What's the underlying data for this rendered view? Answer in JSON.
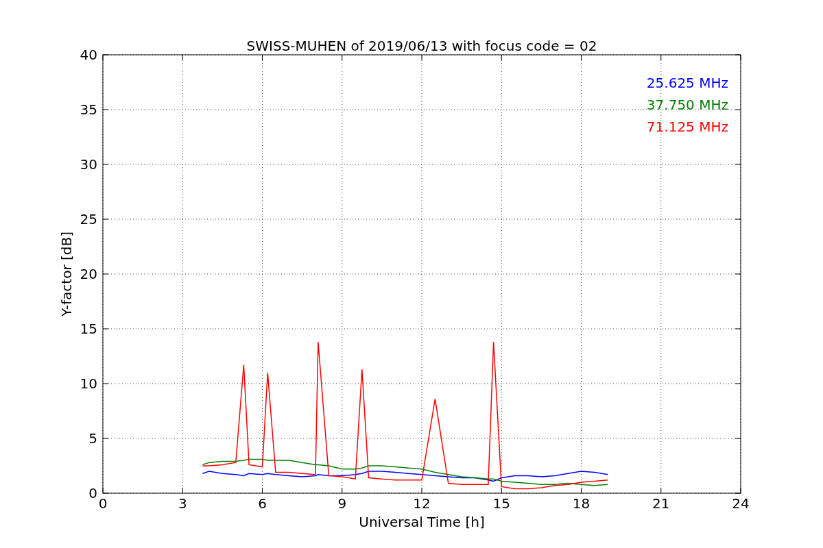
{
  "figure": {
    "chart_data": {
      "type": "line",
      "title": "SWISS-MUHEN of 2019/06/13 with focus code = 02",
      "xlabel": "Universal Time [h]",
      "ylabel": "Y-factor [dB]",
      "x": [
        3.75,
        4,
        4.5,
        5,
        5.3,
        5.5,
        6,
        6.2,
        6.5,
        7,
        7.5,
        8,
        8.1,
        8.5,
        9,
        9.5,
        9.75,
        10,
        10.5,
        11,
        11.5,
        12,
        12.5,
        13,
        13.5,
        14,
        14.5,
        14.7,
        15,
        15.5,
        16,
        16.5,
        17,
        17.5,
        18,
        18.5,
        19
      ],
      "series": [
        {
          "name": "25.625 MHz",
          "color": "#0000ff",
          "values": [
            1.8,
            2,
            1.8,
            1.7,
            1.6,
            1.8,
            1.7,
            1.8,
            1.7,
            1.6,
            1.5,
            1.6,
            1.7,
            1.6,
            1.6,
            1.7,
            1.8,
            2.0,
            2.0,
            1.9,
            1.8,
            1.7,
            1.6,
            1.5,
            1.4,
            1.4,
            1.2,
            1.1,
            1.4,
            1.6,
            1.6,
            1.5,
            1.6,
            1.8,
            2.0,
            1.9,
            1.7
          ]
        },
        {
          "name": "37.750 MHz",
          "color": "#008000",
          "values": [
            2.6,
            2.8,
            2.9,
            2.9,
            3.0,
            3.1,
            3.1,
            3.0,
            3.0,
            3.0,
            2.8,
            2.6,
            2.6,
            2.5,
            2.2,
            2.2,
            2.3,
            2.5,
            2.5,
            2.4,
            2.3,
            2.2,
            1.9,
            1.7,
            1.5,
            1.4,
            1.3,
            1.3,
            1.1,
            1.0,
            0.9,
            0.8,
            0.8,
            0.9,
            0.8,
            0.7,
            0.8
          ]
        },
        {
          "name": "71.125 MHz",
          "color": "#ff0000",
          "values": [
            2.5,
            2.5,
            2.6,
            2.8,
            11.7,
            2.6,
            2.4,
            11.0,
            1.9,
            1.9,
            1.8,
            1.7,
            13.8,
            1.6,
            1.5,
            1.3,
            11.3,
            1.4,
            1.3,
            1.2,
            1.2,
            1.2,
            8.6,
            0.9,
            0.8,
            0.8,
            0.8,
            13.8,
            0.6,
            0.4,
            0.4,
            0.5,
            0.7,
            0.8,
            1.0,
            1.1,
            1.2
          ]
        }
      ],
      "xlim": [
        0,
        24
      ],
      "ylim": [
        0,
        40
      ],
      "xticks": [
        0,
        3,
        6,
        9,
        12,
        15,
        18,
        21,
        24
      ],
      "yticks": [
        0,
        5,
        10,
        15,
        20,
        25,
        30,
        35,
        40
      ],
      "grid": true
    }
  }
}
